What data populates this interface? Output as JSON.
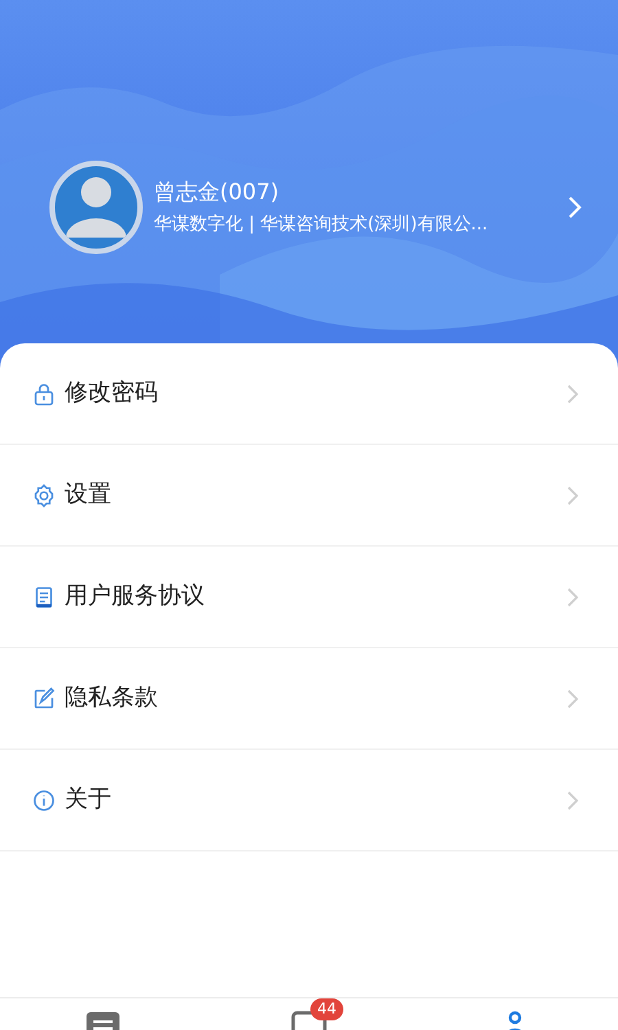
{
  "profile": {
    "name": "曾志金(007)",
    "organization": "华谋数字化 | 华谋咨询技术(深圳)有限公..."
  },
  "menu": [
    {
      "kind": "lock",
      "label": "修改密码"
    },
    {
      "kind": "gear",
      "label": "设置"
    },
    {
      "kind": "document",
      "label": "用户服务协议"
    },
    {
      "kind": "edit",
      "label": "隐私条款"
    },
    {
      "kind": "info",
      "label": "关于"
    }
  ],
  "tabs": [
    {
      "kind": "list",
      "selected": false
    },
    {
      "kind": "message",
      "selected": false,
      "badge": "44"
    },
    {
      "kind": "person",
      "selected": true
    }
  ]
}
